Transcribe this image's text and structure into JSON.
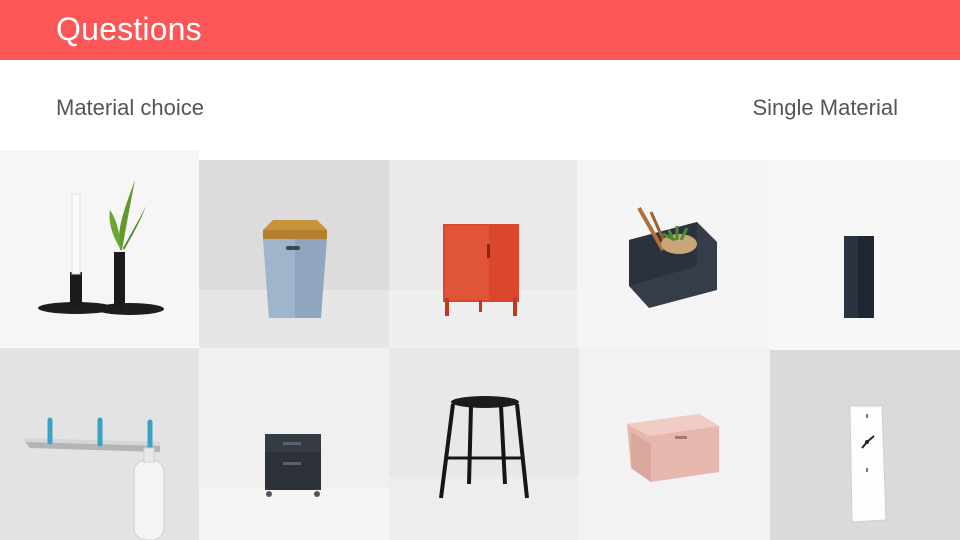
{
  "header": {
    "title": "Questions"
  },
  "labels": {
    "left": "Material choice",
    "right": "Single Material"
  },
  "products": [
    {
      "id": "candle-holders"
    },
    {
      "id": "hex-stool"
    },
    {
      "id": "red-locker"
    },
    {
      "id": "tool-box"
    },
    {
      "id": "wall-pocket"
    },
    {
      "id": "coat-hooks"
    },
    {
      "id": "filing-cabinet"
    },
    {
      "id": "bar-stool"
    },
    {
      "id": "pink-box"
    },
    {
      "id": "wall-clock"
    }
  ],
  "colors": {
    "header": "#fd5656",
    "label_text": "#555555"
  }
}
